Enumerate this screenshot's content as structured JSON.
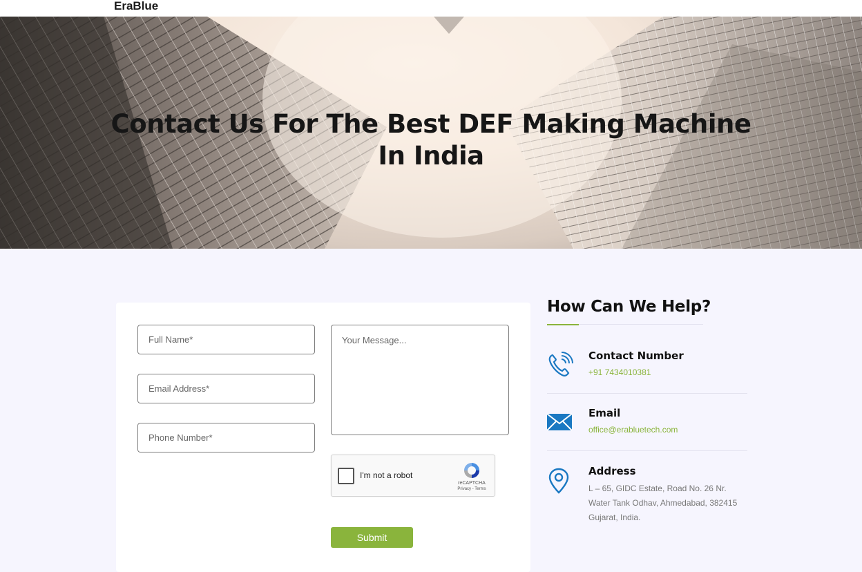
{
  "brand": "EraBlue",
  "hero": {
    "title_line1": "Contact Us For The Best DEF Making Machine",
    "title_line2": "In India"
  },
  "form": {
    "full_name_placeholder": "Full Name*",
    "email_placeholder": "Email Address*",
    "phone_placeholder": "Phone Number*",
    "message_placeholder": "Your Message...",
    "captcha_label": "I'm not a robot",
    "captcha_brand": "reCAPTCHA",
    "captcha_terms": "Privacy - Terms",
    "submit_label": "Submit"
  },
  "help": {
    "title": "How Can We Help?",
    "contact": {
      "title": "Contact Number",
      "value": "+91 7434010381",
      "icon": "phone-icon"
    },
    "email": {
      "title": "Email",
      "value": "office@erabluetech.com",
      "icon": "mail-icon"
    },
    "address": {
      "title": "Address",
      "line1": "L – 65, GIDC Estate, Road No. 26 Nr.",
      "line2": "Water Tank Odhav, Ahmedabad, 382415",
      "line3": "Gujarat, India.",
      "icon": "location-pin-icon"
    }
  },
  "colors": {
    "accent": "#8ab43c",
    "icon_blue": "#1a78c2",
    "page_bg": "#f6f5fe"
  }
}
